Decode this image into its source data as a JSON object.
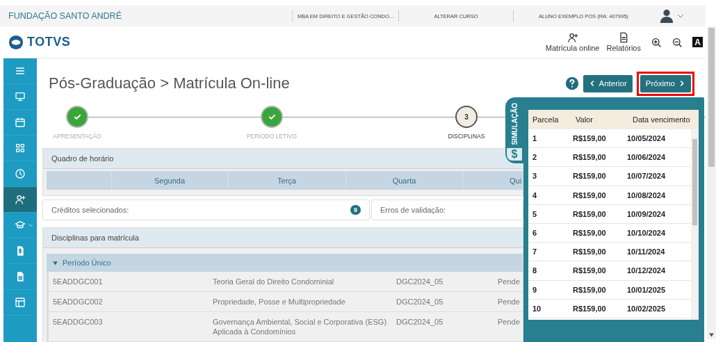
{
  "topbar": {
    "institution": "FUNDAÇÃO SANTO ANDRÉ",
    "course": "MBA EM DIREITO E GESTÃO CONDO...",
    "change_course": "ALTERAR CURSO",
    "student": "ALUNO EXEMPLO POS (RA: 407995)"
  },
  "logo": {
    "text": "TOTVS"
  },
  "toolbar": [
    {
      "kind": "enroll",
      "label": "Matrícula online"
    },
    {
      "kind": "reports",
      "label": "Relatórios"
    },
    {
      "kind": "zoom-in"
    },
    {
      "kind": "zoom-out"
    },
    {
      "kind": "font",
      "label": "A"
    }
  ],
  "sidebar": {
    "items": [
      {
        "kind": "menu",
        "selected": false
      },
      {
        "kind": "monitor",
        "selected": false
      },
      {
        "kind": "calendar",
        "selected": false
      },
      {
        "kind": "grid",
        "selected": false
      },
      {
        "kind": "clock",
        "selected": false
      },
      {
        "kind": "add-user",
        "selected": true
      },
      {
        "kind": "courses",
        "selected": false
      },
      {
        "kind": "money",
        "selected": false
      },
      {
        "kind": "document",
        "selected": false
      },
      {
        "kind": "layout",
        "selected": false
      }
    ]
  },
  "page": {
    "title": "Pós-Graduação > Matrícula On-line",
    "buttons": [
      {
        "kind": "prev",
        "label": "Anterior",
        "highlighted": false
      },
      {
        "kind": "next",
        "label": "Próximo",
        "highlighted": true
      }
    ]
  },
  "stepper": [
    {
      "label": "APRESENTAÇÃO",
      "done": true,
      "current": false
    },
    {
      "label": "PERÍODO LETIVO",
      "done": true,
      "current": false
    },
    {
      "label": "DISCIPLINAS",
      "number": "3",
      "done": false,
      "current": true
    }
  ],
  "schedule": {
    "title": "Quadro de horário",
    "columns": [
      "Segunda",
      "Terça",
      "Quarta",
      "Qui"
    ]
  },
  "summary": {
    "credits_label": "Créditos selecionados:",
    "credits": "9",
    "errors_label": "Erros de validação:"
  },
  "courses": {
    "title": "Disciplinas para matrícula",
    "groups": [
      {
        "name": "Período Único",
        "expanded": true,
        "rows": [
          {
            "code": "5EADDGC001",
            "name": "Teoria Geral do Direito Condominial",
            "class": "DGC2024_05",
            "status": "Pende"
          },
          {
            "code": "5EADDGC002",
            "name": "Propriedade, Posse e Multipropriedade",
            "class": "DGC2024_05",
            "status": "Pende"
          },
          {
            "code": "5EADDGC003",
            "name": "Governança Ambiental, Social e Corporativa (ESG) Aplicada à Condomínios",
            "class": "DGC2024_05",
            "status": "Pende"
          }
        ]
      }
    ]
  },
  "simulation": {
    "tab_label": "SIMULAÇÃO",
    "tab_icon": "$",
    "columns": [
      "Parcela",
      "Valor",
      "Data vencimento"
    ],
    "rows": [
      [
        "1",
        "R$159,00",
        "10/05/2024"
      ],
      [
        "2",
        "R$159,00",
        "10/06/2024"
      ],
      [
        "3",
        "R$159,00",
        "10/07/2024"
      ],
      [
        "4",
        "R$159,00",
        "10/08/2024"
      ],
      [
        "5",
        "R$159,00",
        "10/09/2024"
      ],
      [
        "6",
        "R$159,00",
        "10/10/2024"
      ],
      [
        "7",
        "R$159,00",
        "10/11/2024"
      ],
      [
        "8",
        "R$159,00",
        "10/12/2024"
      ],
      [
        "9",
        "R$159,00",
        "10/01/2025"
      ],
      [
        "10",
        "R$159,00",
        "10/02/2025"
      ]
    ]
  }
}
